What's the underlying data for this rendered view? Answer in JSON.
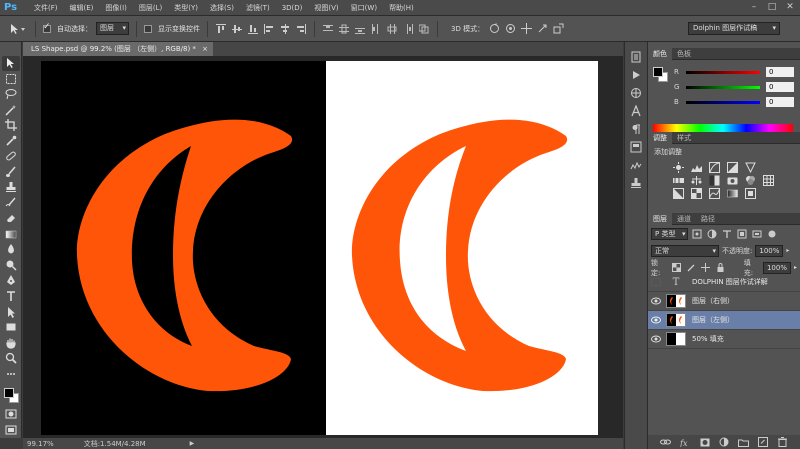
{
  "app": {
    "logo": "Ps",
    "menu": [
      "文件(F)",
      "编辑(E)",
      "图像(I)",
      "图层(L)",
      "类型(Y)",
      "选择(S)",
      "滤镜(T)",
      "3D(D)",
      "视图(V)",
      "窗口(W)",
      "帮助(H)"
    ],
    "window_controls": [
      "–",
      "□",
      "✕"
    ]
  },
  "options": {
    "auto_select_label": "自动选择：",
    "auto_select_target": "图层",
    "show_transform_label": "显示变换控件",
    "mode_3d_label": "3D 模式：",
    "workspace": "Dolphin 图层作试稿"
  },
  "document": {
    "tab_title": "LS Shape.psd @ 99.2% (图层 （左侧）, RGB/8) *",
    "close": "×"
  },
  "status": {
    "zoom": "99.17%",
    "doc_info": "文档:1.54M/4.28M",
    "arrow": "▶"
  },
  "color_panel": {
    "tabs": [
      "颜色",
      "色板"
    ],
    "channels": [
      {
        "label": "R",
        "value": "0",
        "gradient": "linear-gradient(to right,#000,#ff0000)"
      },
      {
        "label": "G",
        "value": "0",
        "gradient": "linear-gradient(to right,#000,#00ff00)"
      },
      {
        "label": "B",
        "value": "0",
        "gradient": "linear-gradient(to right,#000,#0000ff)"
      }
    ]
  },
  "adjustments_panel": {
    "tabs": [
      "调整",
      "样式"
    ],
    "title": "添加调整"
  },
  "layers_panel": {
    "tabs": [
      "图层",
      "通道",
      "路径"
    ],
    "filter_kind": "P 类型",
    "blend_mode": "正常",
    "opacity_label": "不透明度:",
    "opacity_value": "100%",
    "lock_label": "锁定:",
    "fill_label": "填充:",
    "fill_value": "100%",
    "layers": [
      {
        "name": "DOLPHIN 图层作试详解",
        "type": "text",
        "visible": false,
        "selected": false
      },
      {
        "name": "图层（右侧）",
        "type": "shape",
        "visible": true,
        "selected": false
      },
      {
        "name": "图层（左侧）",
        "type": "shape",
        "visible": true,
        "selected": true
      },
      {
        "name": "50% 填充",
        "type": "fill",
        "visible": true,
        "selected": false
      }
    ]
  },
  "colors": {
    "accent": "#ff5508",
    "selection": "#6a7fa8",
    "chrome": "#535353"
  }
}
